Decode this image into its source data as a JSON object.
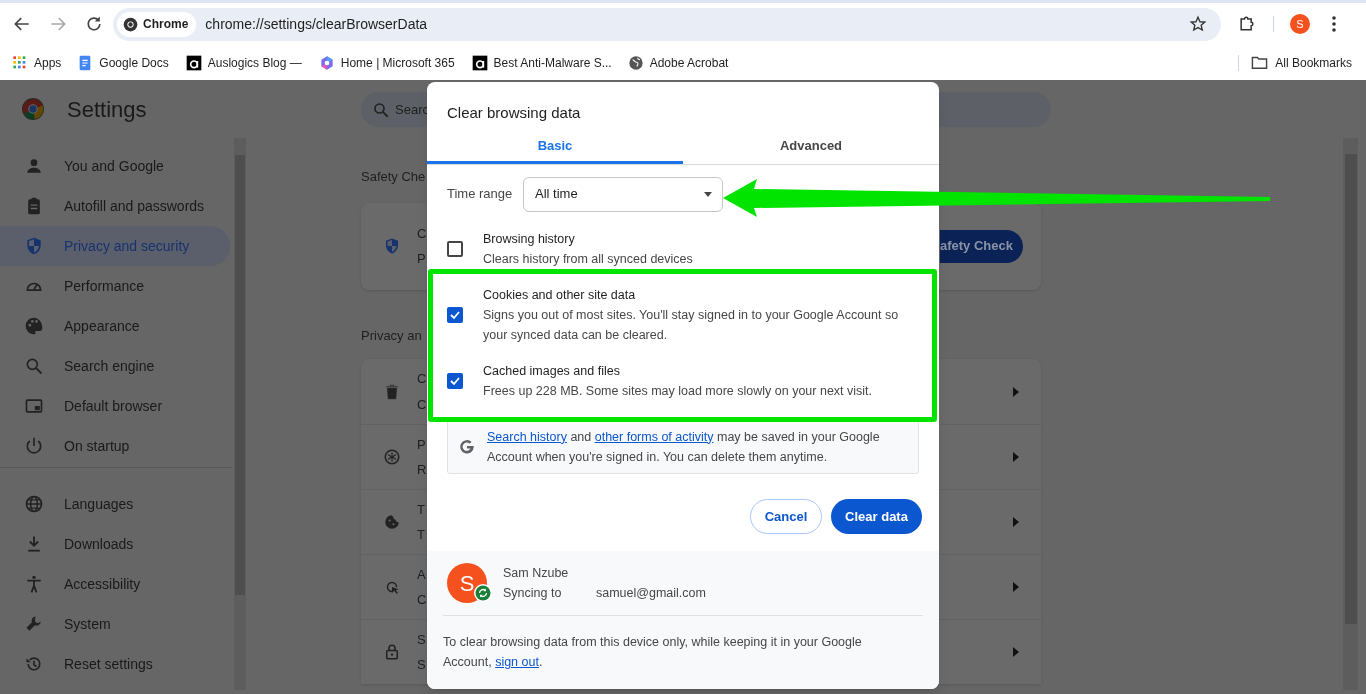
{
  "toolbar": {
    "chip": "Chrome",
    "url": "chrome://settings/clearBrowserData",
    "avatar": "S"
  },
  "bookmarks": [
    {
      "label": "Apps"
    },
    {
      "label": "Google Docs"
    },
    {
      "label": "Auslogics Blog —"
    },
    {
      "label": "Home | Microsoft 365"
    },
    {
      "label": "Best Anti-Malware S..."
    },
    {
      "label": "Adobe Acrobat"
    }
  ],
  "all_bookmarks": "All Bookmarks",
  "settings": {
    "title": "Settings",
    "search_text": "Searc"
  },
  "sidebar": {
    "groups": [
      [
        {
          "label": "You and Google",
          "selected": false
        },
        {
          "label": "Autofill and passwords",
          "selected": false
        },
        {
          "label": "Privacy and security",
          "selected": true
        },
        {
          "label": "Performance",
          "selected": false
        },
        {
          "label": "Appearance",
          "selected": false
        },
        {
          "label": "Search engine",
          "selected": false
        },
        {
          "label": "Default browser",
          "selected": false
        },
        {
          "label": "On startup",
          "selected": false
        }
      ],
      [
        {
          "label": "Languages",
          "selected": false
        },
        {
          "label": "Downloads",
          "selected": false
        },
        {
          "label": "Accessibility",
          "selected": false
        },
        {
          "label": "System",
          "selected": false
        },
        {
          "label": "Reset settings",
          "selected": false
        }
      ]
    ]
  },
  "main": {
    "safety": {
      "heading": "Safety Che",
      "row": [
        "C",
        "P"
      ],
      "button": "afety Check"
    },
    "privacy": {
      "heading": "Privacy an",
      "rows": [
        [
          "C",
          "C"
        ],
        [
          "P",
          "R"
        ],
        [
          "T",
          "T"
        ],
        [
          "A",
          "C"
        ],
        [
          "S",
          "S"
        ]
      ]
    }
  },
  "dialog": {
    "title": "Clear browsing data",
    "tabs": [
      {
        "label": "Basic",
        "selected": true
      },
      {
        "label": "Advanced",
        "selected": false
      }
    ],
    "time_range": {
      "label": "Time range",
      "value": "All time"
    },
    "options": [
      {
        "title": "Browsing history",
        "description": "Clears history from all synced devices",
        "checked": false
      },
      {
        "title": "Cookies and other site data",
        "description": "Signs you out of most sites. You'll stay signed in to your Google Account so your synced data can be cleared.",
        "checked": true
      },
      {
        "title": "Cached images and files",
        "description": "Frees up 228 MB. Some sites may load more slowly on your next visit.",
        "checked": true
      }
    ],
    "info": [
      {
        "kind": "link",
        "text": "Search history"
      },
      {
        "kind": "text",
        "text": " and "
      },
      {
        "kind": "link",
        "text": "other forms of activity"
      },
      {
        "kind": "text",
        "text": " may be saved in your Google Account when you're signed in. You can delete them anytime."
      }
    ],
    "buttons": {
      "cancel": "Cancel",
      "confirm": "Clear data"
    },
    "account": {
      "avatar": "S",
      "name": "Sam Nzube",
      "sync_label": "Syncing to",
      "email": "samuel@gmail.com"
    },
    "note": [
      {
        "kind": "text",
        "text": "To clear browsing data from this device only, while keeping it in your Google Account, "
      },
      {
        "kind": "link",
        "text": "sign out"
      },
      {
        "kind": "text",
        "text": "."
      }
    ]
  }
}
